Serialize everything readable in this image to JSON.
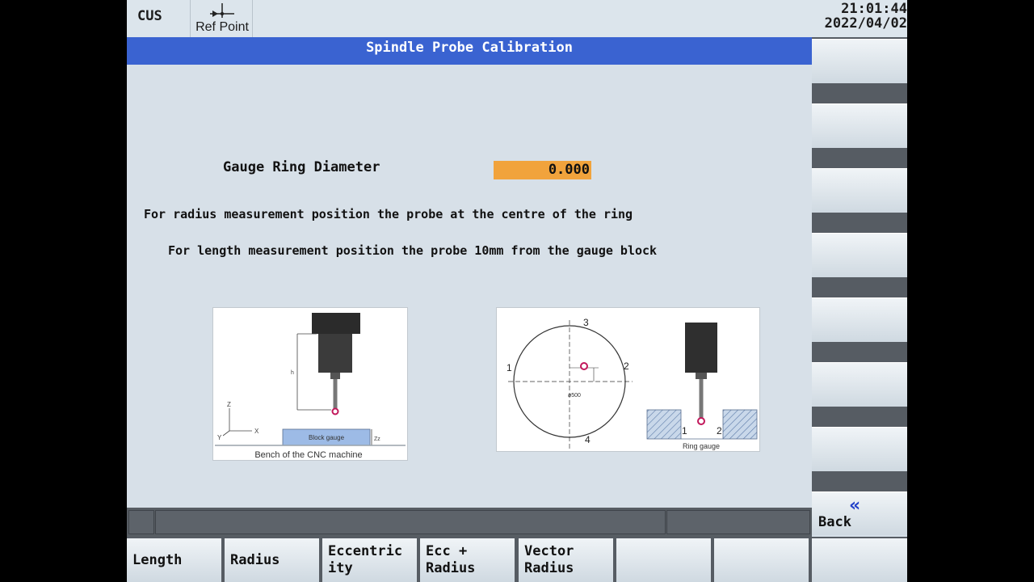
{
  "header": {
    "mode": "CUS",
    "ref_point_label": "Ref Point",
    "time": "21:01:44",
    "date": "2022/04/02"
  },
  "title": "Spindle Probe Calibration",
  "form": {
    "gauge_ring_label": "Gauge Ring Diameter",
    "gauge_ring_value": "0.000",
    "gauge_ring_field_color": "#f1a33c"
  },
  "instructions": {
    "radius": "For radius measurement position the probe at the centre of the ring",
    "length": "For length measurement position the probe 10mm from the gauge block"
  },
  "figures": {
    "length": {
      "caption": "Bench of the CNC machine",
      "block_label": "Block gauge",
      "axis_z": "Z",
      "axis_x": "X",
      "axis_y": "Y"
    },
    "ring": {
      "caption": "Ring gauge",
      "points": [
        "1",
        "2",
        "3",
        "4"
      ],
      "dim_500": "ø500",
      "inset_points": [
        "1",
        "2"
      ]
    }
  },
  "right_softkeys": {
    "back_label": "Back",
    "back_icon": "double-chevron-left-icon"
  },
  "bottom_softkeys": [
    {
      "label": "Length"
    },
    {
      "label": "Radius"
    },
    {
      "label": "Eccentric\nity"
    },
    {
      "label": "Ecc +\nRadius"
    },
    {
      "label": "Vector\nRadius"
    },
    {
      "label": ""
    },
    {
      "label": ""
    },
    {
      "label": ""
    }
  ],
  "colors": {
    "title_bar": "#3a63d1",
    "accent_value": "#f1a33c",
    "back_chevron": "#2341c9"
  }
}
